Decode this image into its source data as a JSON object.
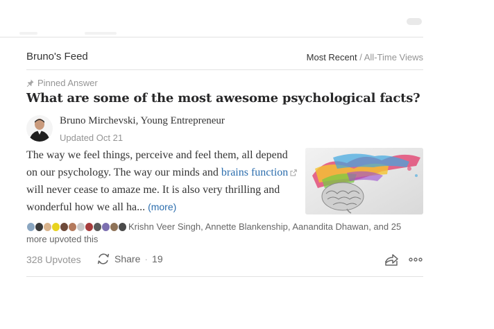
{
  "feed": {
    "title": "Bruno's Feed",
    "sort_active": "Most Recent",
    "sort_separator": " / ",
    "sort_alt": "All-Time Views"
  },
  "answer": {
    "pinned_label": "Pinned Answer",
    "question": "What are some of the most awesome psychological facts?",
    "author": "Bruno Mirchevski, Young Entrepreneur",
    "updated": "Updated Oct 21",
    "text_1": "The way we feel things, perceive and feel them, all depend on our psychology. The way our minds and ",
    "link_text": "brains function",
    "text_2": " will never cease to amaze me. It is also very thrilling and wonderful how we all ha... ",
    "more_label": "(more)",
    "upvoters_text": "Krishn Veer Singh, Annette Blankenship, Aanandita Dhawan, and 25 more upvoted this",
    "upvotes": "328 Upvotes",
    "share_label": "Share",
    "share_dot": "·",
    "share_count": "19"
  },
  "icons": {
    "pinned": "pin-icon",
    "share": "share-cycle-icon",
    "send": "share-arrow-icon",
    "more": "more-dots-icon",
    "external": "external-link-icon"
  },
  "colors": {
    "link": "#2b6dad",
    "muted": "#949494",
    "text": "#333333"
  }
}
